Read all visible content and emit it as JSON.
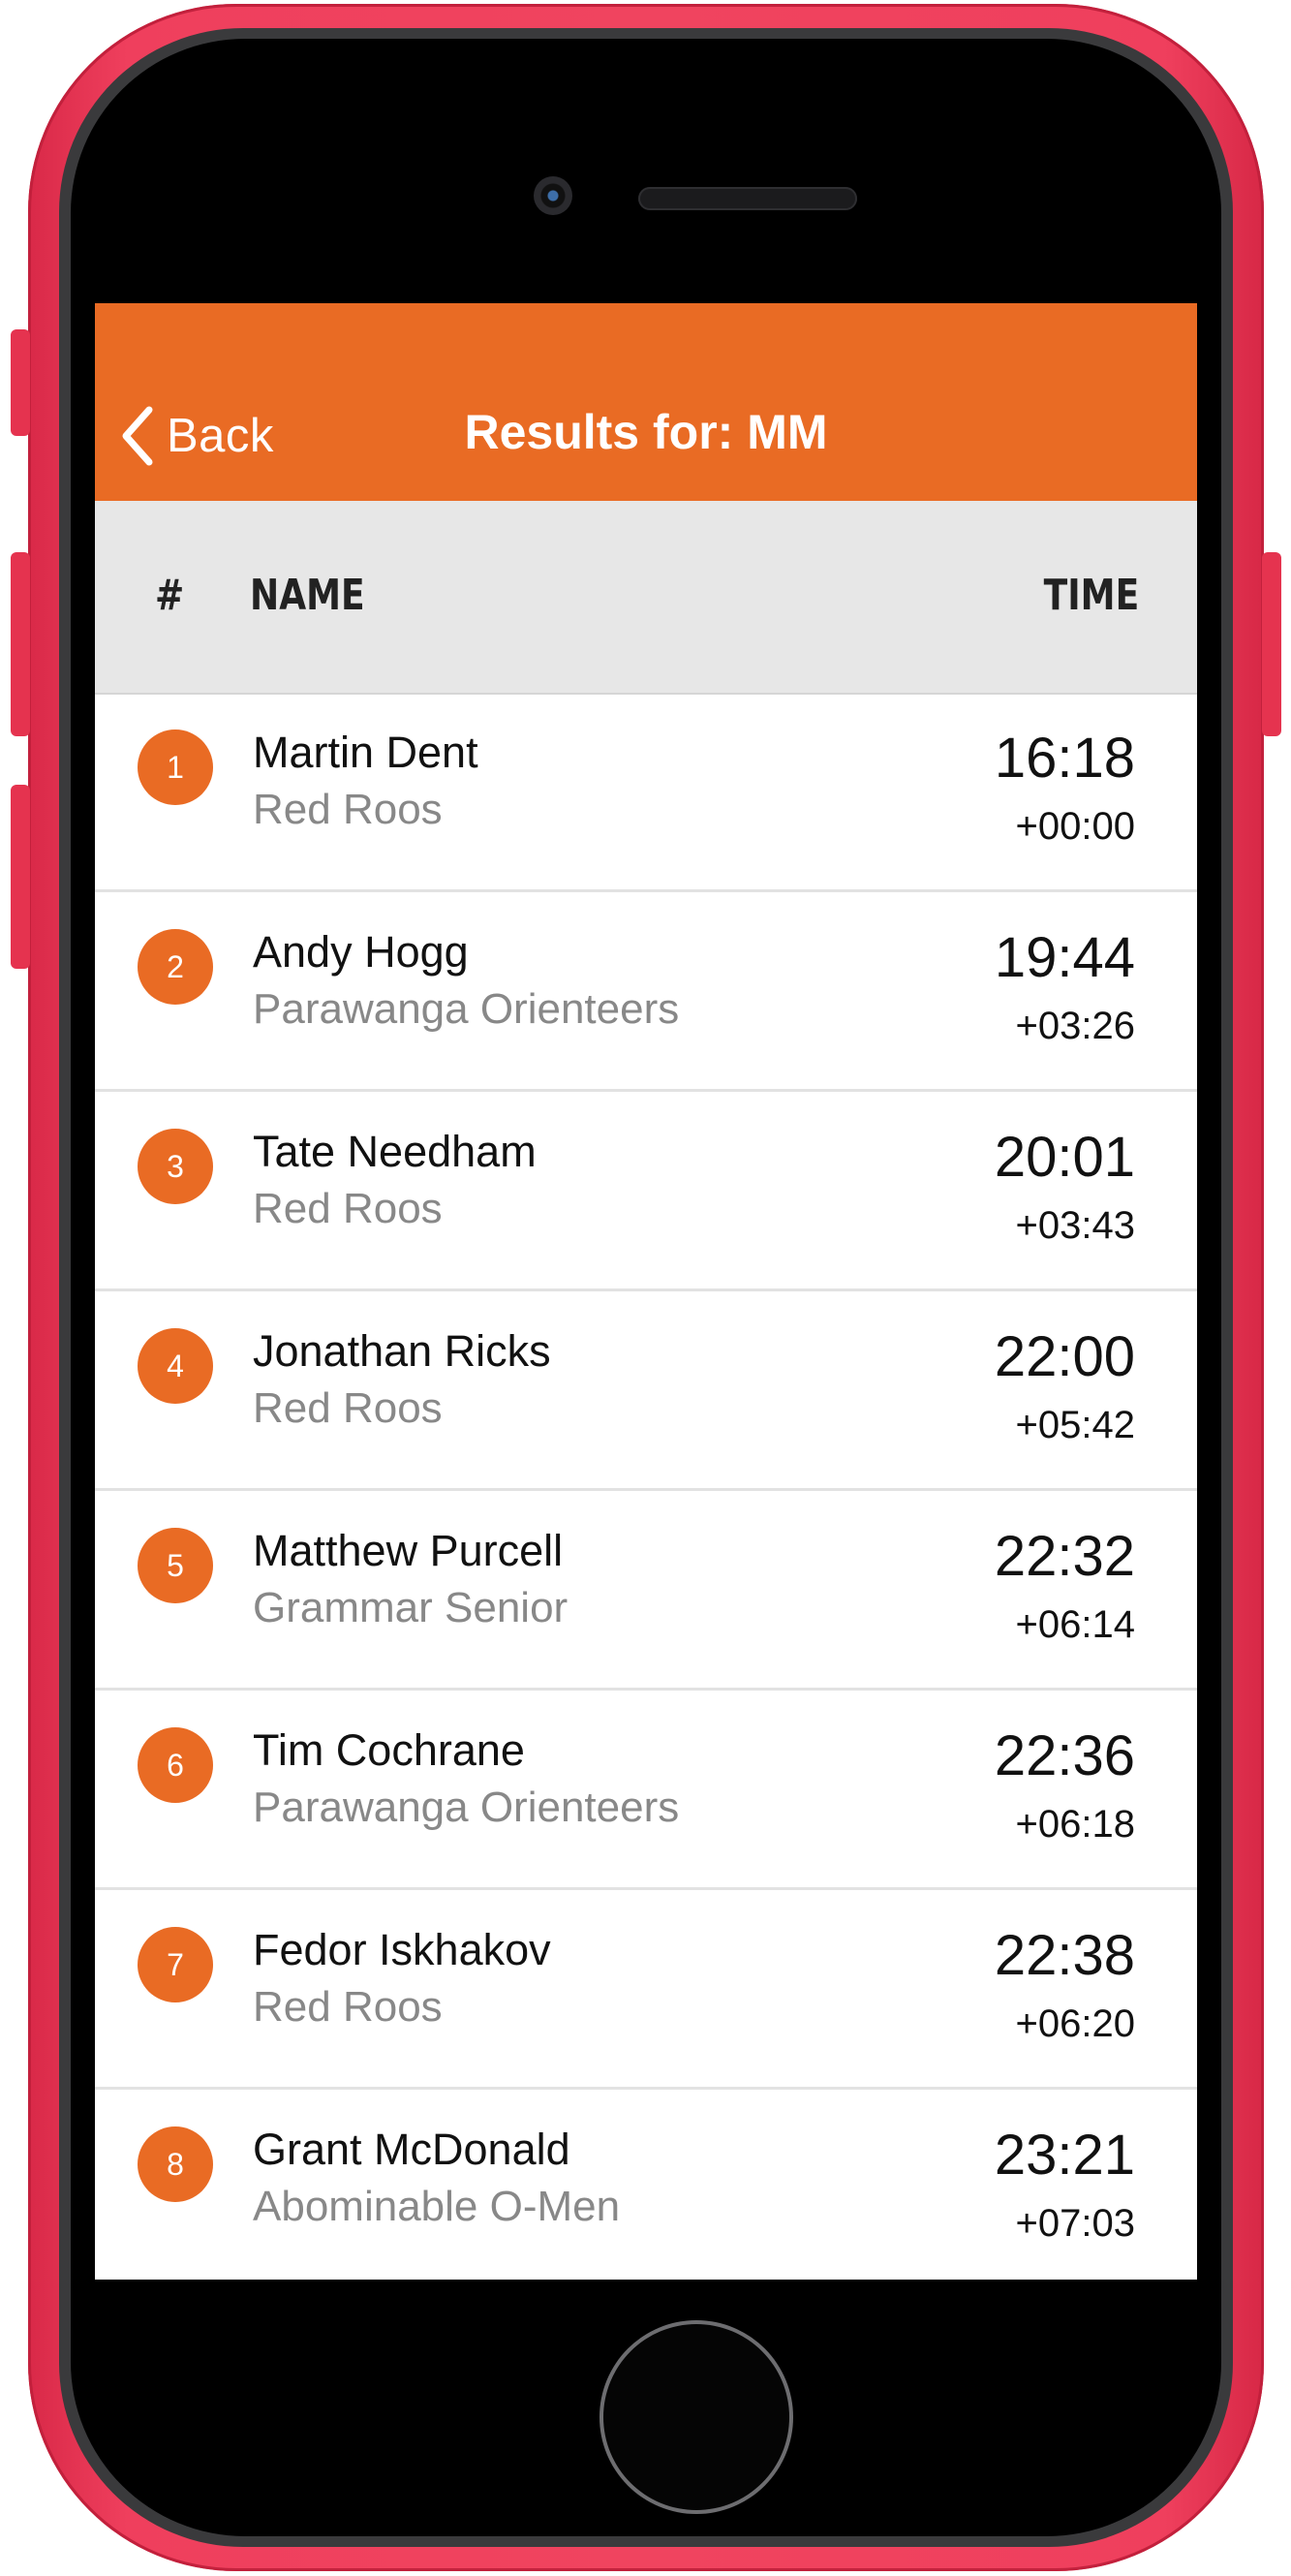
{
  "nav": {
    "back_label": "Back",
    "title": "Results for: MM"
  },
  "columns": {
    "rank": "#",
    "name": "NAME",
    "time": "TIME"
  },
  "colors": {
    "accent": "#e96b24",
    "phone_body": "#f0445f",
    "header_bg": "#e7e7e7"
  },
  "results": [
    {
      "rank": "1",
      "name": "Martin Dent",
      "club": "Red Roos",
      "time": "16:18",
      "diff": "+00:00"
    },
    {
      "rank": "2",
      "name": "Andy Hogg",
      "club": "Parawanga Orienteers",
      "time": "19:44",
      "diff": "+03:26"
    },
    {
      "rank": "3",
      "name": "Tate Needham",
      "club": "Red Roos",
      "time": "20:01",
      "diff": "+03:43"
    },
    {
      "rank": "4",
      "name": "Jonathan Ricks",
      "club": "Red Roos",
      "time": "22:00",
      "diff": "+05:42"
    },
    {
      "rank": "5",
      "name": "Matthew Purcell",
      "club": "Grammar Senior",
      "time": "22:32",
      "diff": "+06:14"
    },
    {
      "rank": "6",
      "name": "Tim Cochrane",
      "club": "Parawanga Orienteers",
      "time": "22:36",
      "diff": "+06:18"
    },
    {
      "rank": "7",
      "name": "Fedor Iskhakov",
      "club": "Red Roos",
      "time": "22:38",
      "diff": "+06:20"
    },
    {
      "rank": "8",
      "name": "Grant McDonald",
      "club": "Abominable O-Men",
      "time": "23:21",
      "diff": "+07:03"
    }
  ]
}
